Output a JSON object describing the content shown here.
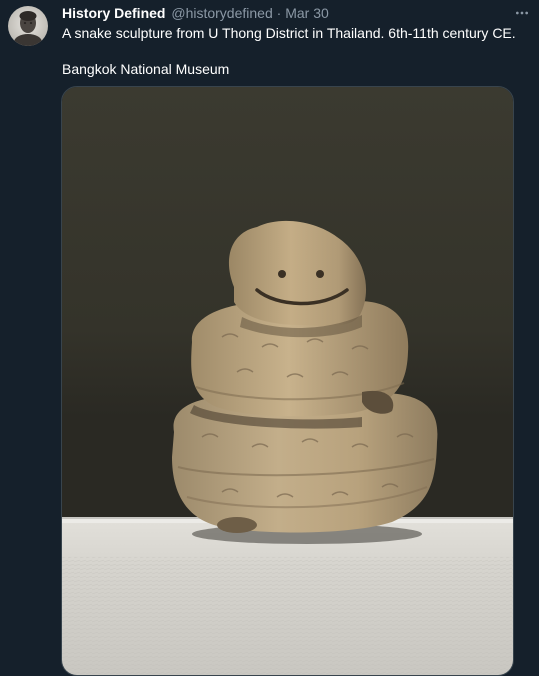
{
  "tweet": {
    "author": {
      "display_name": "History Defined",
      "handle": "@historydefined",
      "avatar_icon": "bust-portrait-icon"
    },
    "separator": "·",
    "timestamp": "Mar 30",
    "text_lines": [
      "A snake sculpture from U Thong District in Thailand. 6th-11th century CE.",
      "Bangkok National Museum"
    ],
    "media": {
      "icon": "photo-snake-sculpture"
    },
    "more_icon": "more-horizontal-icon"
  },
  "colors": {
    "background": "#15202b",
    "primary_text": "#ffffff",
    "secondary_text": "#8b98a5",
    "border": "#38444d"
  }
}
